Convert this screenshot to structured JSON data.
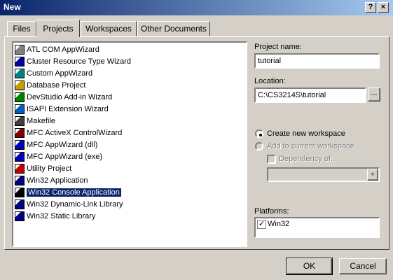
{
  "window": {
    "title": "New",
    "help_glyph": "?",
    "close_glyph": "×"
  },
  "tabs": [
    {
      "label": "Files"
    },
    {
      "label": "Projects"
    },
    {
      "label": "Workspaces"
    },
    {
      "label": "Other Documents"
    }
  ],
  "project_types": [
    {
      "label": "ATL COM AppWizard",
      "icon": "atl-icon",
      "color": "#808080"
    },
    {
      "label": "Cluster Resource Type Wizard",
      "icon": "cluster-icon",
      "color": "#0000a0"
    },
    {
      "label": "Custom AppWizard",
      "icon": "custom-wizard-icon",
      "color": "#008080"
    },
    {
      "label": "Database Project",
      "icon": "database-icon",
      "color": "#c0a000"
    },
    {
      "label": "DevStudio Add-in Wizard",
      "icon": "addin-icon",
      "color": "#008000"
    },
    {
      "label": "ISAPI Extension Wizard",
      "icon": "globe-icon",
      "color": "#0060c0"
    },
    {
      "label": "Makefile",
      "icon": "makefile-icon",
      "color": "#404040"
    },
    {
      "label": "MFC ActiveX ControlWizard",
      "icon": "activex-icon",
      "color": "#800000"
    },
    {
      "label": "MFC AppWizard (dll)",
      "icon": "mfc-dll-icon",
      "color": "#0000c0"
    },
    {
      "label": "MFC AppWizard (exe)",
      "icon": "mfc-exe-icon",
      "color": "#0000c0"
    },
    {
      "label": "Utility Project",
      "icon": "utility-icon",
      "color": "#c00000"
    },
    {
      "label": "Win32 Application",
      "icon": "win32-app-icon",
      "color": "#000080"
    },
    {
      "label": "Win32 Console Application",
      "icon": "console-icon",
      "color": "#000000"
    },
    {
      "label": "Win32 Dynamic-Link Library",
      "icon": "dll-icon",
      "color": "#000080"
    },
    {
      "label": "Win32 Static Library",
      "icon": "lib-icon",
      "color": "#000080"
    }
  ],
  "selected_index": 12,
  "project_name": {
    "label": "Project name:",
    "value": "tutorial"
  },
  "location": {
    "label": "Location:",
    "value": "C:\\CS3214S\\tutorial",
    "browse_label": "..."
  },
  "workspace": {
    "create_label": "Create new workspace",
    "add_label": "Add to current workspace",
    "dependency_label": "Dependency of:"
  },
  "platforms": {
    "label": "Platforms:",
    "items": [
      {
        "label": "Win32",
        "checked": true
      }
    ]
  },
  "buttons": {
    "ok": "OK",
    "cancel": "Cancel"
  },
  "colors": {
    "selection": "#0a246a",
    "face": "#d4d0c8",
    "title_start": "#0a246a",
    "title_end": "#a6caf0"
  }
}
